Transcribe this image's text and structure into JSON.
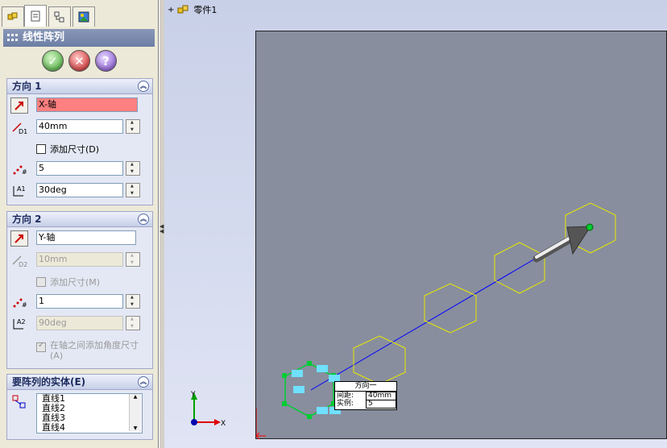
{
  "feature_manager": {
    "title": "线性阵列",
    "tabs": [
      {
        "icon": "part-icon"
      },
      {
        "icon": "property-manager-icon"
      },
      {
        "icon": "configuration-icon"
      },
      {
        "icon": "display-manager-icon"
      }
    ],
    "actions": {
      "ok": "✓",
      "cancel": "✕",
      "help": "?"
    },
    "direction1": {
      "heading": "方向 1",
      "axis": "X-轴",
      "spacing": "40mm",
      "add_dimension": "添加尺寸(D)",
      "instances": "5",
      "angle": "30deg"
    },
    "direction2": {
      "heading": "方向 2",
      "axis": "Y-轴",
      "spacing": "10mm",
      "add_dimension": "添加尺寸(M)",
      "instances": "1",
      "angle": "90deg",
      "add_angle": "在轴之间添加角度尺寸(A)"
    },
    "bodies": {
      "heading": "要阵列的实体(E)",
      "items": [
        "直线1",
        "直线2",
        "直线3",
        "直线4"
      ]
    }
  },
  "graphics": {
    "tree_item": "零件1",
    "callout": {
      "title": "方向一",
      "spacing_label": "间距:",
      "spacing_value": "40mm",
      "instances_label": "实例:",
      "instances_value": "5"
    },
    "axis_labels": {
      "x": "X",
      "y": "Y"
    },
    "colors": {
      "sketch_bg": "#888e9e",
      "pattern_instance": "#e8e800",
      "selected_seed": "#00cc33",
      "direction_line": "#0000ff",
      "field_highlight": "#ff8080"
    }
  }
}
